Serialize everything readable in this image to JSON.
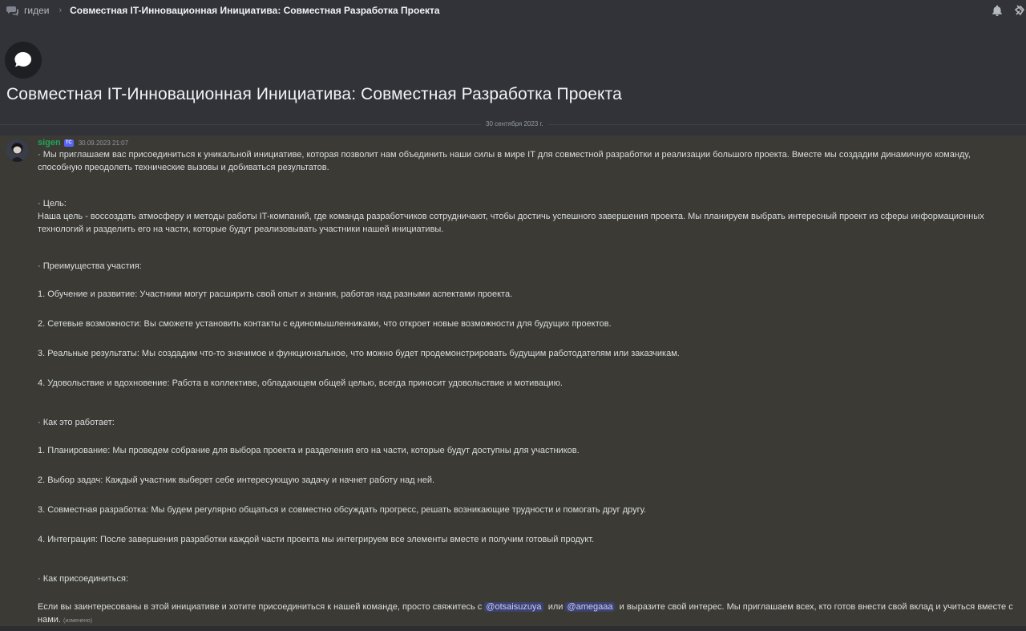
{
  "topbar": {
    "crumb": "гидеи",
    "separator": "›",
    "title": "Совместная IT-Инновационная Инициатива: Совместная Разработка Проекта"
  },
  "thread": {
    "heading": "Совместная IT-Инновационная Инициатива: Совместная Разработка Проекта",
    "date_divider": "30 сентября 2023 г."
  },
  "message": {
    "author": "sigen",
    "badge": "ТС",
    "timestamp": "30.09.2023 21:07",
    "intro": "· Мы приглашаем вас присоединиться к уникальной инициативе, которая позволит нам объединить наши силы в мире IT для совместной разработки и реализации большого проекта. Вместе мы создадим динамичную команду, способную преодолеть технические вызовы и добиваться результатов.",
    "goal_heading": "· Цель:",
    "goal_text": "Наша цель - воссоздать атмосферу и методы работы IT-компаний, где команда разработчиков сотрудничают, чтобы достичь успешного завершения проекта. Мы планируем выбрать интересный проект из сферы информационных технологий и разделить его на части, которые будут реализовывать участники нашей инициативы.",
    "benefits_heading": "· Преимущества участия:",
    "benefits": [
      "1. Обучение и развитие: Участники могут расширить свой опыт и знания, работая над разными аспектами проекта.",
      "2. Сетевые возможности: Вы сможете установить контакты с единомышленниками, что откроет новые возможности для будущих проектов.",
      "3. Реальные результаты: Мы создадим что-то значимое и функциональное, что можно будет продемонстрировать будущим работодателям или заказчикам.",
      "4. Удовольствие и вдохновение: Работа в коллективе, обладающем общей целью, всегда приносит удовольствие и мотивацию."
    ],
    "how_heading": "· Как это работает:",
    "how": [
      "1. Планирование: Мы проведем собрание для выбора проекта и разделения его на части, которые будут доступны для участников.",
      "2. Выбор задач: Каждый участник выберет себе интересующую задачу и начнет работу над ней.",
      "3. Совместная разработка: Мы будем регулярно общаться и совместно обсуждать прогресс, решать возникающие трудности и помогать друг другу.",
      "4. Интеграция: После завершения разработки каждой части проекта мы интегрируем все элементы вместе и получим готовый продукт."
    ],
    "join_heading": "· Как присоединиться:",
    "join_prefix": "Если вы заинтересованы в этой инициативе и хотите присоединиться к нашей команде, просто свяжитесь с",
    "mention1": "@otsaisuzuya",
    "join_middle": "или",
    "mention2": "@amegaaa",
    "join_suffix": "и выразите свой интерес. Мы приглашаем всех, кто готов внести свой вклад и учиться вместе с нами.",
    "edited": "(изменено)"
  },
  "colors": {
    "background": "#313338",
    "message_highlight": "#3b3a34",
    "username": "#23a55a",
    "mention_bg": "#3c4270"
  },
  "icons": [
    "forum-icon",
    "bell-icon",
    "pin-icon",
    "chat-bubble-icon"
  ]
}
